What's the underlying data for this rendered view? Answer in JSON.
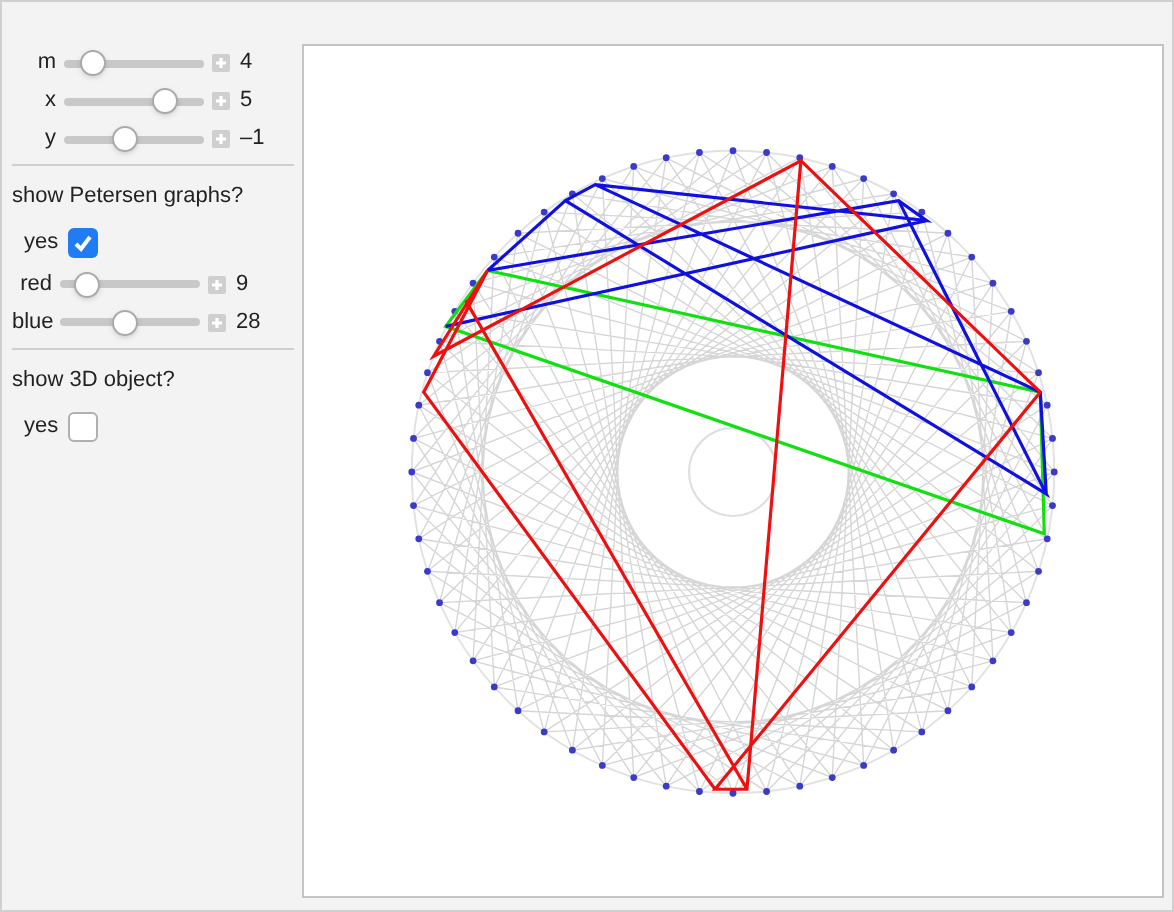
{
  "sections": [
    {
      "controls": [
        {
          "kind": "slider",
          "label": "m",
          "level": 0.2,
          "value": "4"
        },
        {
          "kind": "slider",
          "label": "x",
          "level": 0.72,
          "value": "5"
        },
        {
          "kind": "slider",
          "label": "y",
          "level": 0.43,
          "value": "–1"
        }
      ]
    },
    {
      "heading": "show Petersen graphs?",
      "controls": [
        {
          "kind": "checkbox",
          "label": "yes",
          "checked": true
        },
        {
          "kind": "slider",
          "label": "red",
          "level": 0.18,
          "value": "9"
        },
        {
          "kind": "slider",
          "label": "blue",
          "level": 0.46,
          "value": "28"
        }
      ]
    },
    {
      "heading": "show 3D object?",
      "controls": [
        {
          "kind": "checkbox",
          "label": "yes",
          "checked": false
        }
      ]
    }
  ]
}
